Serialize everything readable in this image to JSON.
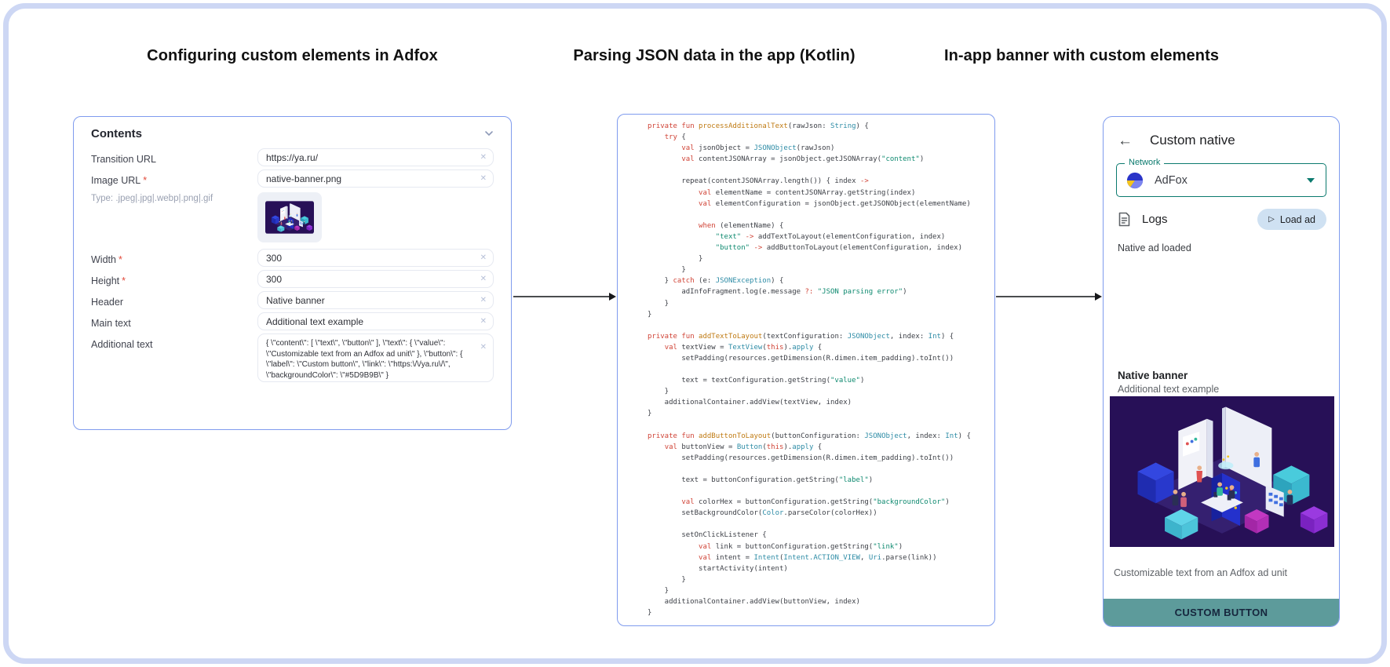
{
  "titles": {
    "left": "Configuring custom elements in Adfox",
    "middle": "Parsing JSON data in the app (Kotlin)",
    "right": "In-app banner with custom elements"
  },
  "icons": {
    "clear": "✕",
    "back": "←",
    "play": "▷"
  },
  "colors": {
    "frame_border": "#cdd7f4",
    "card_border": "#7f9bee",
    "accent_teal": "#0b7a6e",
    "load_button_bg": "#cfe1f2",
    "custom_button_bg": "#5d9b9b",
    "banner_bg": "#271057"
  },
  "adfox_form": {
    "section_title": "Contents",
    "required_mark": "*",
    "fields": [
      {
        "label": "Transition URL",
        "value": "https://ya.ru/"
      },
      {
        "label": "Image URL",
        "required": true,
        "value": "native-banner.png",
        "hint": "Type: .jpeg|.jpg|.webp|.png|.gif"
      },
      {
        "label": "Width",
        "required": true,
        "value": "300"
      },
      {
        "label": "Height",
        "required": true,
        "value": "300"
      },
      {
        "label": "Header",
        "value": "Native banner"
      },
      {
        "label": "Main text",
        "value": "Additional text example"
      },
      {
        "label": "Additional text",
        "value": "{  \\\"content\\\": [   \\\"text\\\",   \\\"button\\\" ],  \\\"text\\\": {   \\\"value\\\": \\\"Customizable text from an Adfox ad unit\\\"  },  \\\"button\\\": {  \\\"label\\\": \\\"Custom button\\\",    \\\"link\\\": \\\"https:\\/\\/ya.ru\\/\\\",  \\\"backgroundColor\\\": \\\"#5D9B9B\\\"  }"
      }
    ]
  },
  "kotlin_code": {
    "lines": [
      [
        [
          "k",
          "private"
        ],
        [
          "p",
          " "
        ],
        [
          "k",
          "fun"
        ],
        [
          "p",
          " "
        ],
        [
          "f",
          "processAdditionalText"
        ],
        [
          "p",
          "(rawJson: "
        ],
        [
          "t",
          "String"
        ],
        [
          "p",
          ") {"
        ]
      ],
      [
        [
          "p",
          "    "
        ],
        [
          "k",
          "try"
        ],
        [
          "p",
          " {"
        ]
      ],
      [
        [
          "p",
          "        "
        ],
        [
          "k",
          "val"
        ],
        [
          "p",
          " jsonObject = "
        ],
        [
          "t",
          "JSONObject"
        ],
        [
          "p",
          "(rawJson)"
        ]
      ],
      [
        [
          "p",
          "        "
        ],
        [
          "k",
          "val"
        ],
        [
          "p",
          " contentJSONArray = jsonObject.getJSONArray("
        ],
        [
          "s",
          "\"content\""
        ],
        [
          "p",
          ")"
        ]
      ],
      [],
      [
        [
          "p",
          "        repeat(contentJSONArray.length()) { index "
        ],
        [
          "k",
          "->"
        ]
      ],
      [
        [
          "p",
          "            "
        ],
        [
          "k",
          "val"
        ],
        [
          "p",
          " elementName = contentJSONArray.getString(index)"
        ]
      ],
      [
        [
          "p",
          "            "
        ],
        [
          "k",
          "val"
        ],
        [
          "p",
          " elementConfiguration = jsonObject.getJSONObject(elementName)"
        ]
      ],
      [],
      [
        [
          "p",
          "            "
        ],
        [
          "k",
          "when"
        ],
        [
          "p",
          " (elementName) {"
        ]
      ],
      [
        [
          "p",
          "                "
        ],
        [
          "s",
          "\"text\""
        ],
        [
          "p",
          " "
        ],
        [
          "k",
          "->"
        ],
        [
          "p",
          " addTextToLayout(elementConfiguration, index)"
        ]
      ],
      [
        [
          "p",
          "                "
        ],
        [
          "s",
          "\"button\""
        ],
        [
          "p",
          " "
        ],
        [
          "k",
          "->"
        ],
        [
          "p",
          " addButtonToLayout(elementConfiguration, index)"
        ]
      ],
      [
        [
          "p",
          "            }"
        ]
      ],
      [
        [
          "p",
          "        }"
        ]
      ],
      [
        [
          "p",
          "    } "
        ],
        [
          "k",
          "catch"
        ],
        [
          "p",
          " (e: "
        ],
        [
          "t",
          "JSONException"
        ],
        [
          "p",
          ") {"
        ]
      ],
      [
        [
          "p",
          "        adInfoFragment.log(e.message "
        ],
        [
          "k",
          "?:"
        ],
        [
          "p",
          " "
        ],
        [
          "s",
          "\"JSON parsing error\""
        ],
        [
          "p",
          ")"
        ]
      ],
      [
        [
          "p",
          "    }"
        ]
      ],
      [
        [
          "p",
          "}"
        ]
      ],
      [],
      [
        [
          "k",
          "private"
        ],
        [
          "p",
          " "
        ],
        [
          "k",
          "fun"
        ],
        [
          "p",
          " "
        ],
        [
          "f",
          "addTextToLayout"
        ],
        [
          "p",
          "(textConfiguration: "
        ],
        [
          "t",
          "JSONObject"
        ],
        [
          "p",
          ", index: "
        ],
        [
          "t",
          "Int"
        ],
        [
          "p",
          ") {"
        ]
      ],
      [
        [
          "p",
          "    "
        ],
        [
          "k",
          "val"
        ],
        [
          "p",
          " textView = "
        ],
        [
          "t",
          "TextView"
        ],
        [
          "p",
          "("
        ],
        [
          "k",
          "this"
        ],
        [
          "p",
          ")."
        ],
        [
          "t",
          "apply"
        ],
        [
          "p",
          " {"
        ]
      ],
      [
        [
          "p",
          "        setPadding(resources.getDimension(R.dimen.item_padding).toInt())"
        ]
      ],
      [],
      [
        [
          "p",
          "        text = textConfiguration.getString("
        ],
        [
          "s",
          "\"value\""
        ],
        [
          "p",
          ")"
        ]
      ],
      [
        [
          "p",
          "    }"
        ]
      ],
      [
        [
          "p",
          "    additionalContainer.addView(textView, index)"
        ]
      ],
      [
        [
          "p",
          "}"
        ]
      ],
      [],
      [
        [
          "k",
          "private"
        ],
        [
          "p",
          " "
        ],
        [
          "k",
          "fun"
        ],
        [
          "p",
          " "
        ],
        [
          "f",
          "addButtonToLayout"
        ],
        [
          "p",
          "(buttonConfiguration: "
        ],
        [
          "t",
          "JSONObject"
        ],
        [
          "p",
          ", index: "
        ],
        [
          "t",
          "Int"
        ],
        [
          "p",
          ") {"
        ]
      ],
      [
        [
          "p",
          "    "
        ],
        [
          "k",
          "val"
        ],
        [
          "p",
          " buttonView = "
        ],
        [
          "t",
          "Button"
        ],
        [
          "p",
          "("
        ],
        [
          "k",
          "this"
        ],
        [
          "p",
          ")."
        ],
        [
          "t",
          "apply"
        ],
        [
          "p",
          " {"
        ]
      ],
      [
        [
          "p",
          "        setPadding(resources.getDimension(R.dimen.item_padding).toInt())"
        ]
      ],
      [],
      [
        [
          "p",
          "        text = buttonConfiguration.getString("
        ],
        [
          "s",
          "\"label\""
        ],
        [
          "p",
          ")"
        ]
      ],
      [],
      [
        [
          "p",
          "        "
        ],
        [
          "k",
          "val"
        ],
        [
          "p",
          " colorHex = buttonConfiguration.getString("
        ],
        [
          "s",
          "\"backgroundColor\""
        ],
        [
          "p",
          ")"
        ]
      ],
      [
        [
          "p",
          "        setBackgroundColor("
        ],
        [
          "t",
          "Color"
        ],
        [
          "p",
          ".parseColor(colorHex))"
        ]
      ],
      [],
      [
        [
          "p",
          "        setOnClickListener {"
        ]
      ],
      [
        [
          "p",
          "            "
        ],
        [
          "k",
          "val"
        ],
        [
          "p",
          " link = buttonConfiguration.getString("
        ],
        [
          "s",
          "\"link\""
        ],
        [
          "p",
          ")"
        ]
      ],
      [
        [
          "p",
          "            "
        ],
        [
          "k",
          "val"
        ],
        [
          "p",
          " intent = "
        ],
        [
          "t",
          "Intent"
        ],
        [
          "p",
          "("
        ],
        [
          "t",
          "Intent.ACTION_VIEW"
        ],
        [
          "p",
          ", "
        ],
        [
          "t",
          "Uri"
        ],
        [
          "p",
          ".parse(link))"
        ]
      ],
      [
        [
          "p",
          "            startActivity(intent)"
        ]
      ],
      [
        [
          "p",
          "        }"
        ]
      ],
      [
        [
          "p",
          "    }"
        ]
      ],
      [
        [
          "p",
          "    additionalContainer.addView(buttonView, index)"
        ]
      ],
      [
        [
          "p",
          "}"
        ]
      ]
    ]
  },
  "app": {
    "appbar": {
      "title": "Custom native"
    },
    "network_select": {
      "label": "Network",
      "value": "AdFox"
    },
    "logs": {
      "title": "Logs",
      "load_button_label": "Load ad"
    },
    "log_text": "Native ad loaded",
    "ad": {
      "header": "Native banner",
      "main_text": "Additional text example",
      "additional_text": "Customizable text from an Adfox ad unit",
      "button_label": "CUSTOM BUTTON"
    }
  }
}
